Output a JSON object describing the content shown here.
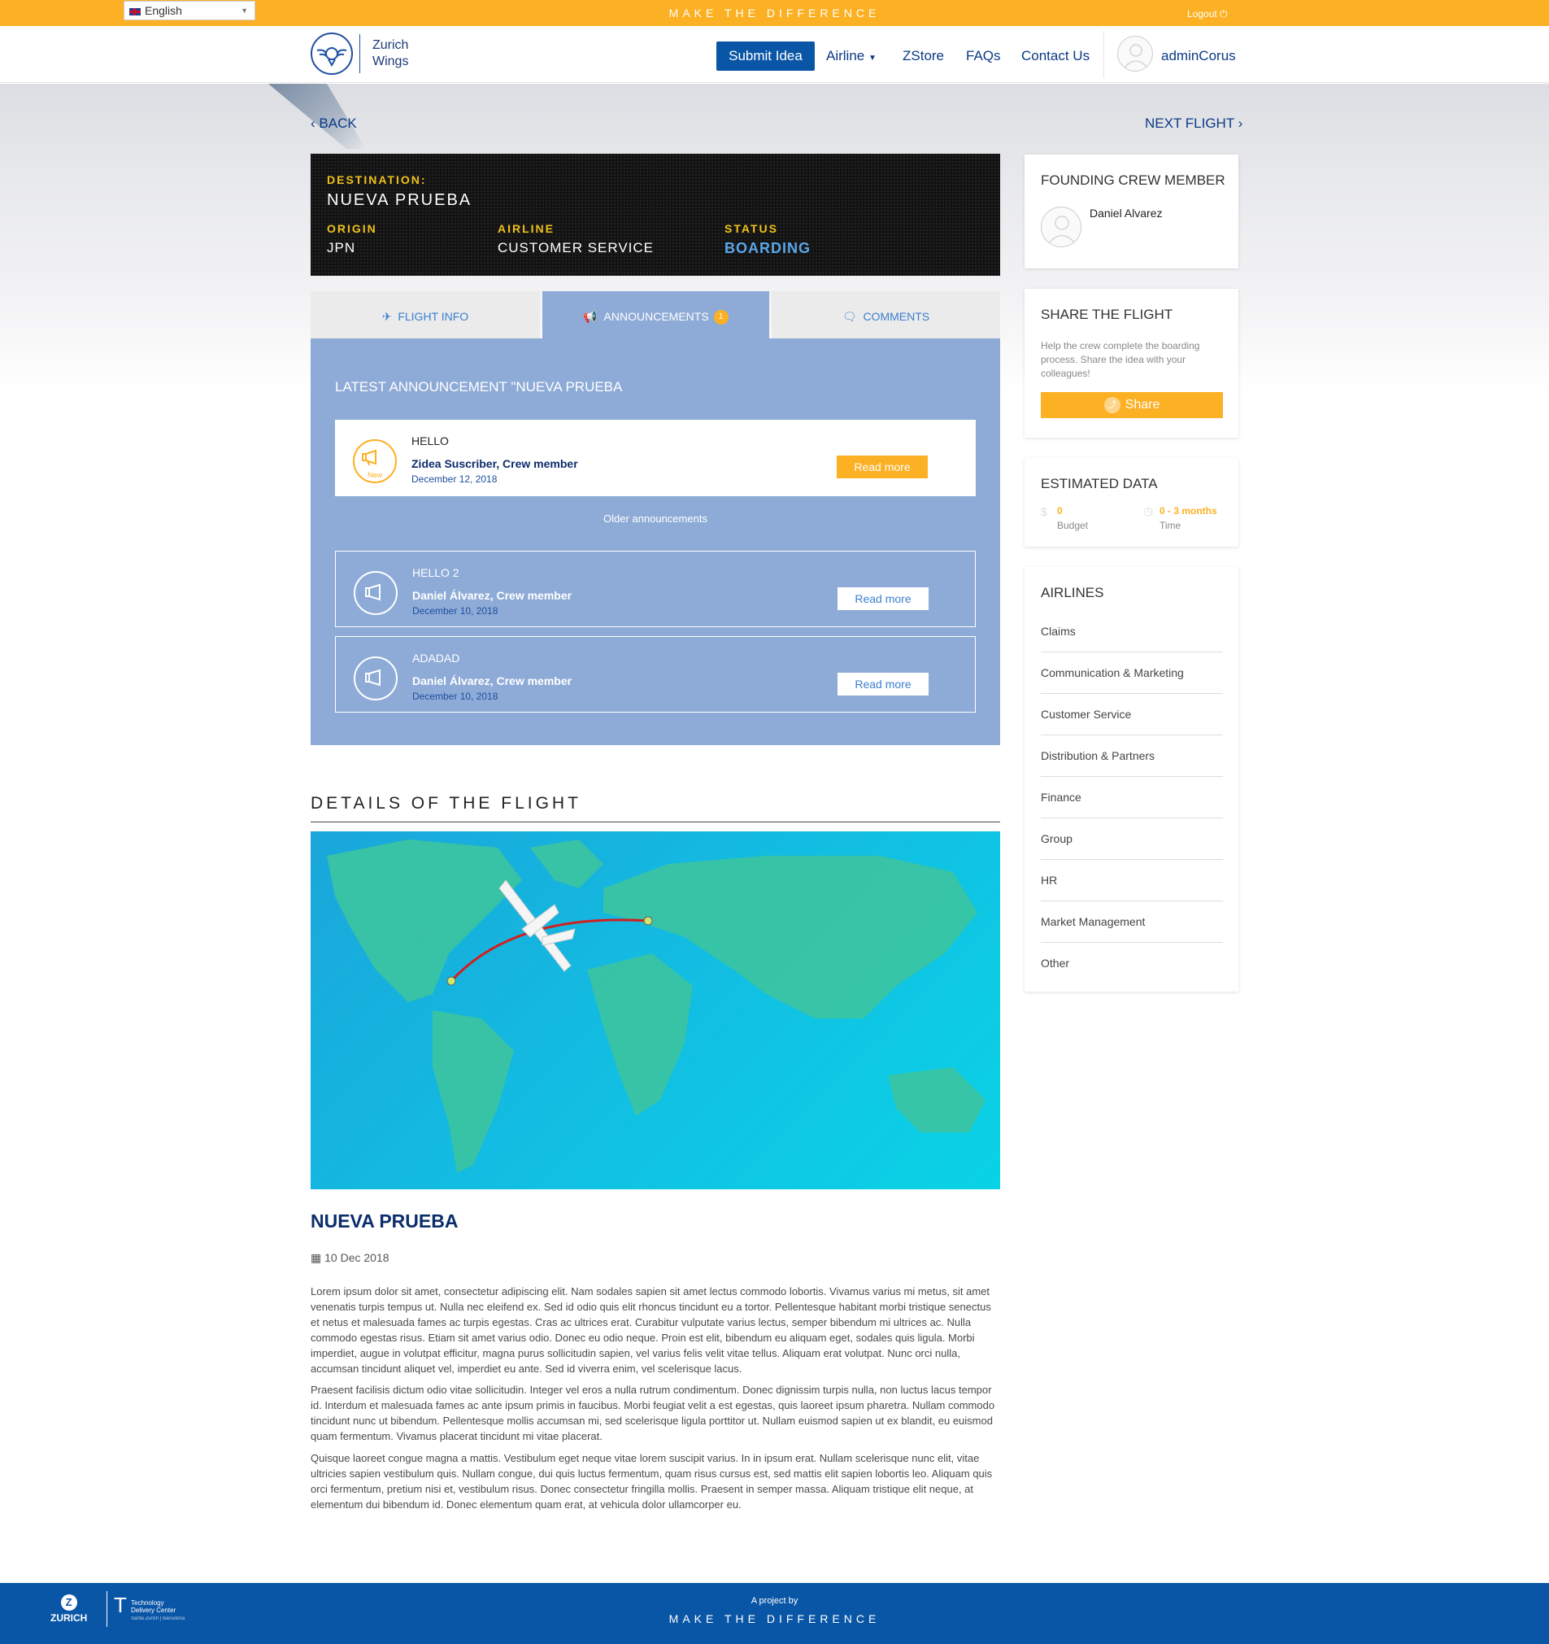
{
  "topbar": {
    "language": "English",
    "tagline": "MAKE THE DIFFERENCE",
    "logout": "Logout"
  },
  "header": {
    "logo_line1": "Zurich",
    "logo_line2": "Wings",
    "nav": {
      "submit_idea": "Submit Idea",
      "airline": "Airline",
      "zstore": "ZStore",
      "faqs": "FAQs",
      "contact": "Contact Us"
    },
    "user_name": "adminCorus"
  },
  "navigation": {
    "back": "BACK",
    "next": "NEXT FLIGHT"
  },
  "board": {
    "destination_label": "DESTINATION:",
    "destination": "NUEVA PRUEBA",
    "origin_label": "ORIGIN",
    "origin": "JPN",
    "airline_label": "AIRLINE",
    "airline": "CUSTOMER SERVICE",
    "status_label": "STATUS",
    "status": "BOARDING"
  },
  "tabs": {
    "flight_info": "FLIGHT INFO",
    "announcements": "ANNOUNCEMENTS",
    "announcements_count": "1",
    "comments": "COMMENTS"
  },
  "announcements": {
    "latest_title": "LATEST ANNOUNCEMENT \"NUEVA PRUEBA",
    "older_label": "Older announcements",
    "new_label": "New",
    "read_more": "Read more",
    "items": [
      {
        "title": "HELLO",
        "author": "Zidea Suscriber, Crew member",
        "date": "December 12, 2018"
      },
      {
        "title": "HELLO 2",
        "author": "Daniel Álvarez, Crew member",
        "date": "December 10, 2018"
      },
      {
        "title": "ADADAD",
        "author": "Daniel Álvarez, Crew member",
        "date": "December 10, 2018"
      }
    ]
  },
  "details": {
    "section_title": "DETAILS OF THE FLIGHT",
    "flight_title": "NUEVA PRUEBA",
    "date": "10 Dec 2018",
    "paragraphs": [
      "Lorem ipsum dolor sit amet, consectetur adipiscing elit. Nam sodales sapien sit amet lectus commodo lobortis. Vivamus varius mi metus, sit amet venenatis turpis tempus ut. Nulla nec eleifend ex. Sed id odio quis elit rhoncus tincidunt eu a tortor. Pellentesque habitant morbi tristique senectus et netus et malesuada fames ac turpis egestas. Cras ac ultrices erat. Curabitur vulputate varius lectus, semper bibendum mi ultrices ac. Nulla commodo egestas risus. Etiam sit amet varius odio. Donec eu odio neque. Proin est elit, bibendum eu aliquam eget, sodales quis ligula. Morbi imperdiet, augue in volutpat efficitur, magna purus sollicitudin sapien, vel varius felis velit vitae tellus. Aliquam erat volutpat. Nunc orci nulla, accumsan tincidunt aliquet vel, imperdiet eu ante. Sed id viverra enim, vel scelerisque lacus.",
      "Praesent facilisis dictum odio vitae sollicitudin. Integer vel eros a nulla rutrum condimentum. Donec dignissim turpis nulla, non luctus lacus tempor id. Interdum et malesuada fames ac ante ipsum primis in faucibus. Morbi feugiat velit a est egestas, quis laoreet ipsum pharetra. Nullam commodo tincidunt nunc ut bibendum. Pellentesque mollis accumsan mi, sed scelerisque ligula porttitor ut. Nullam euismod sapien ut ex blandit, eu euismod quam fermentum. Vivamus placerat tincidunt mi vitae placerat.",
      "Quisque laoreet congue magna a mattis. Vestibulum eget neque vitae lorem suscipit varius. In in ipsum erat. Nullam scelerisque nunc elit, vitae ultricies sapien vestibulum quis. Nullam congue, dui quis luctus fermentum, quam risus cursus est, sed mattis elit sapien lobortis leo. Aliquam quis orci fermentum, pretium nisi et, vestibulum risus. Donec consectetur fringilla mollis. Praesent in semper massa. Aliquam tristique elit neque, at elementum dui bibendum id. Donec elementum quam erat, at vehicula dolor ullamcorper eu."
    ]
  },
  "sidebar": {
    "founding": {
      "title": "FOUNDING CREW MEMBER",
      "name": "Daniel Alvarez"
    },
    "share": {
      "title": "SHARE THE FLIGHT",
      "description": "Help the crew complete the boarding process. Share the idea with your colleagues!",
      "button": "Share"
    },
    "estimated": {
      "title": "ESTIMATED DATA",
      "budget_value": "0",
      "budget_label": "Budget",
      "time_value": "0 - 3 months",
      "time_label": "Time"
    },
    "airlines": {
      "title": "AIRLINES",
      "items": [
        "Claims",
        "Communication & Marketing",
        "Customer Service",
        "Distribution & Partners",
        "Finance",
        "Group",
        "HR",
        "Market Management",
        "Other"
      ]
    }
  },
  "footer": {
    "zurich": "ZURICH",
    "tdc_line1": "Technology",
    "tdc_line2": "Delivery Center",
    "tdc_line3": "Santa Zurich | Barcelona",
    "project_by": "A project by",
    "tagline": "MAKE THE DIFFERENCE"
  },
  "colors": {
    "accent": "#fcb023",
    "brand_blue": "#0a56a6",
    "panel_blue": "#8eabd7",
    "status_blue": "#5aa7e8"
  }
}
